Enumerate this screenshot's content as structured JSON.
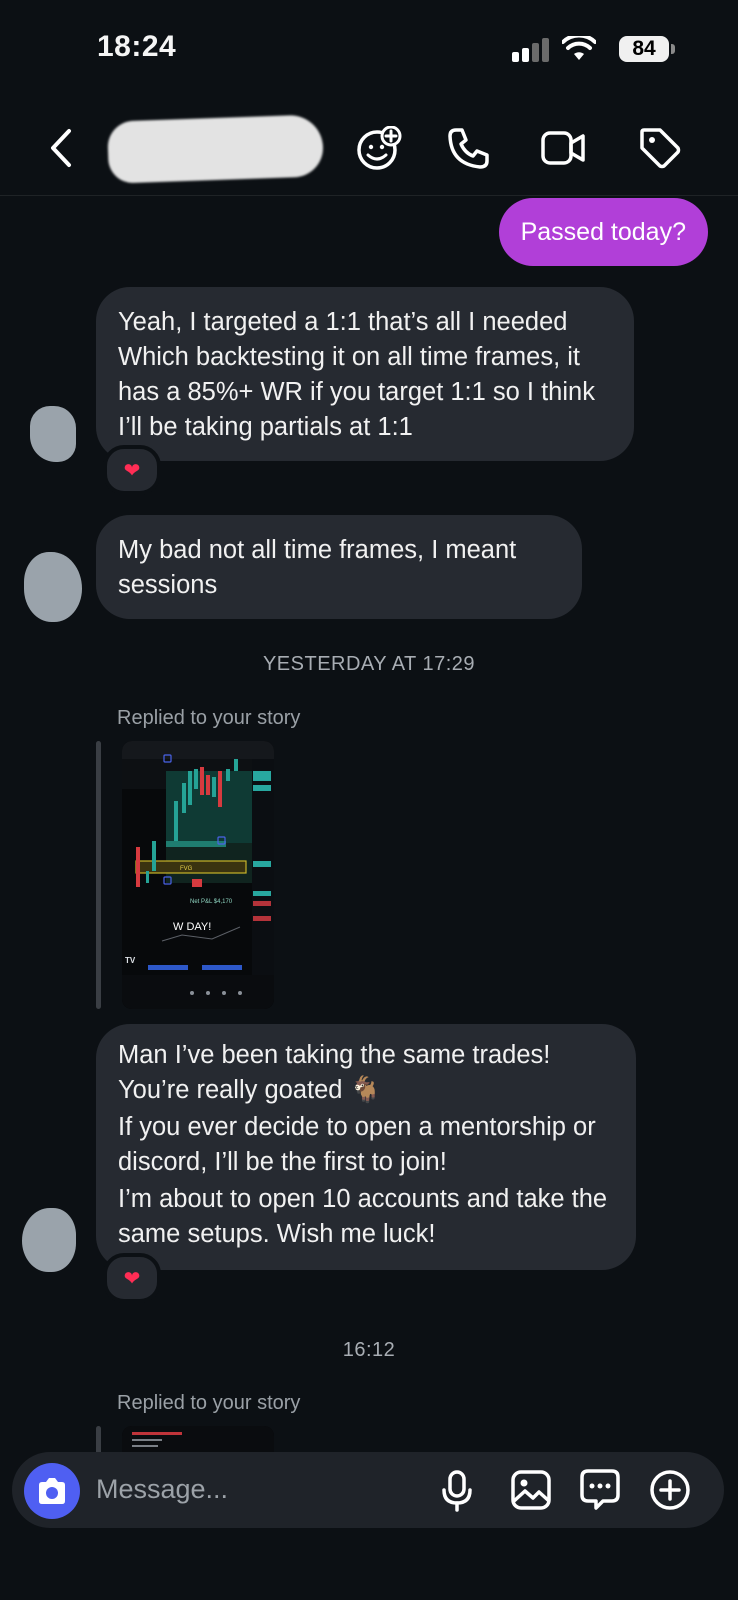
{
  "status_bar": {
    "time": "18:24",
    "battery": "84"
  },
  "header": {
    "contact_name_redacted": true,
    "icons": [
      "back-chevron-icon",
      "add-sticker-icon",
      "phone-icon",
      "video-camera-icon",
      "tag-icon"
    ]
  },
  "messages": {
    "outgoing_1": "Passed today?",
    "incoming_1": [
      "Yeah, I targeted a 1:1 that’s all I needed",
      "Which backtesting it on all time frames, it has a 85%+ WR if you target 1:1 so I think I’ll be taking partials at 1:1"
    ],
    "incoming_1_reaction": "❤",
    "incoming_2": "My bad not all time frames, I meant sessions",
    "divider_1": "YESTERDAY AT 17:29",
    "story_reply_label_1": "Replied to your story",
    "story_1": {
      "fvg_label": "FVG",
      "net_pnl": "Net P&L $4,170",
      "caption": "W DAY!",
      "logo": "TV"
    },
    "incoming_3": [
      "Man I’ve been taking the same trades! You’re really goated 🐐",
      "If you ever decide to open a mentorship or discord, I’ll be the first to join!",
      "I’m about to open 10 accounts and take the same setups. Wish me luck!"
    ],
    "incoming_3_reaction": "❤",
    "divider_2": "16:12",
    "story_reply_label_2": "Replied to your story"
  },
  "composer": {
    "placeholder": "Message..."
  },
  "colors": {
    "background": "#0c1014",
    "outgoing_bubble": "#b13fd8",
    "incoming_bubble": "#262a31",
    "camera_button": "#4f5ff2"
  }
}
